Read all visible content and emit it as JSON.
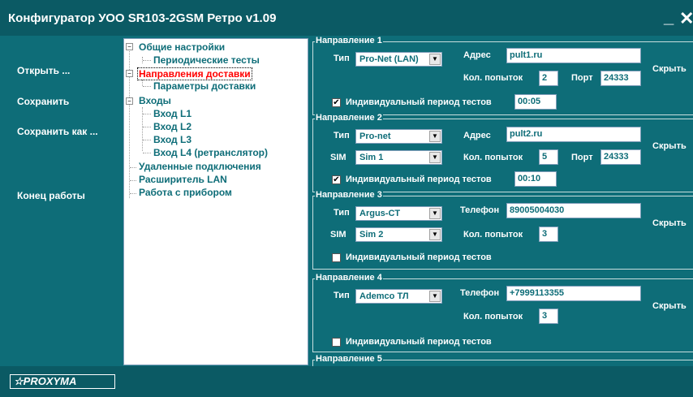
{
  "window": {
    "title": "Конфигуратор УОО SR103-2GSM Ретро v1.09",
    "minimize": "_",
    "close": "✕"
  },
  "menu": {
    "open": "Открыть ...",
    "save": "Сохранить",
    "save_as": "Сохранить как ...",
    "exit": "Конец  работы"
  },
  "tree": [
    "Общие настройки",
    "Периодические тесты",
    "Направления доставки",
    "Параметры доставки",
    "Входы",
    "Вход L1",
    "Вход L2",
    "Вход L3",
    "Вход L4 (ретранслятор)",
    "Удаленные подключения",
    "Расширитель LAN",
    "Работа с прибором"
  ],
  "labels": {
    "type": "Тип",
    "sim": "SIM",
    "address": "Адрес",
    "phone": "Телефон",
    "attempts": "Кол. попыток",
    "port": "Порт",
    "individual_period": "Индивидуальный период тестов",
    "hide": "Скрыть"
  },
  "directions": [
    {
      "title": "Направление 1",
      "type": "Pro-Net (LAN)",
      "address": "pult1.ru",
      "attempts": "2",
      "port": "24333",
      "individual": true,
      "period": "00:05"
    },
    {
      "title": "Направление 2",
      "type": "Pro-net",
      "sim": "Sim 1",
      "address": "pult2.ru",
      "attempts": "5",
      "port": "24333",
      "individual": true,
      "period": "00:10"
    },
    {
      "title": "Направление 3",
      "type": "Argus-CT",
      "sim": "Sim 2",
      "phone": "89005004030",
      "attempts": "3",
      "individual": false
    },
    {
      "title": "Направление 4",
      "type": "Ademco ТЛ",
      "phone": "+7999113355",
      "attempts": "3",
      "individual": false
    },
    {
      "title": "Направление 5"
    }
  ],
  "footer": {
    "logo": "☆PROXYMA"
  },
  "icons": {
    "dropdown": "chevron-down-icon",
    "expander": "minus-box-icon",
    "check": "checkmark-icon"
  }
}
